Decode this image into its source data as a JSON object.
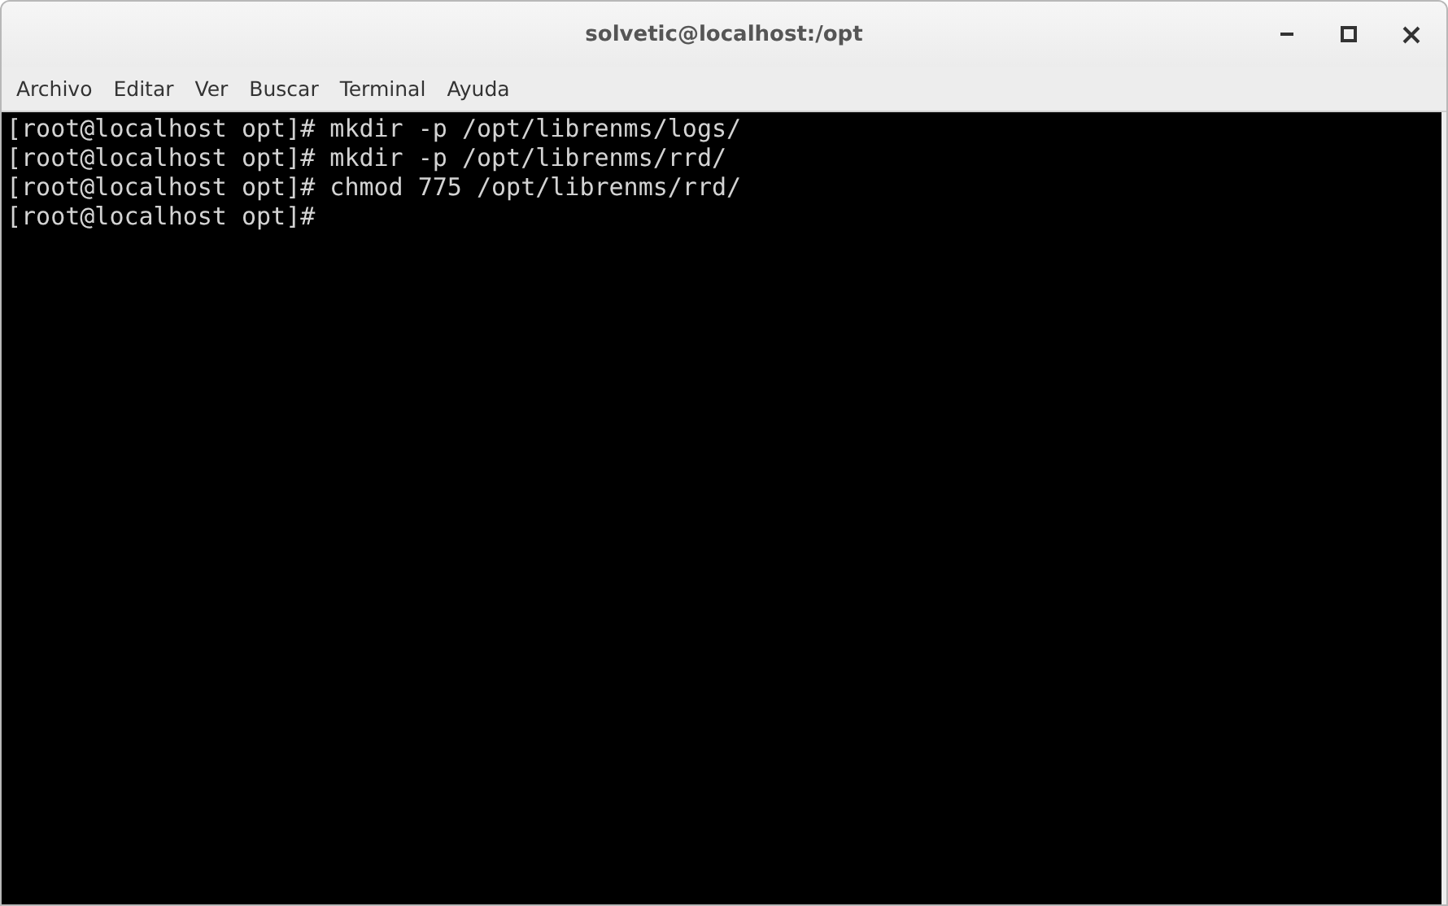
{
  "window": {
    "title": "solvetic@localhost:/opt"
  },
  "menu": [
    "Archivo",
    "Editar",
    "Ver",
    "Buscar",
    "Terminal",
    "Ayuda"
  ],
  "terminal": {
    "lines": [
      "[root@localhost opt]# mkdir -p /opt/librenms/logs/",
      "[root@localhost opt]# mkdir -p /opt/librenms/rrd/",
      "[root@localhost opt]# chmod 775 /opt/librenms/rrd/",
      "[root@localhost opt]#"
    ]
  }
}
